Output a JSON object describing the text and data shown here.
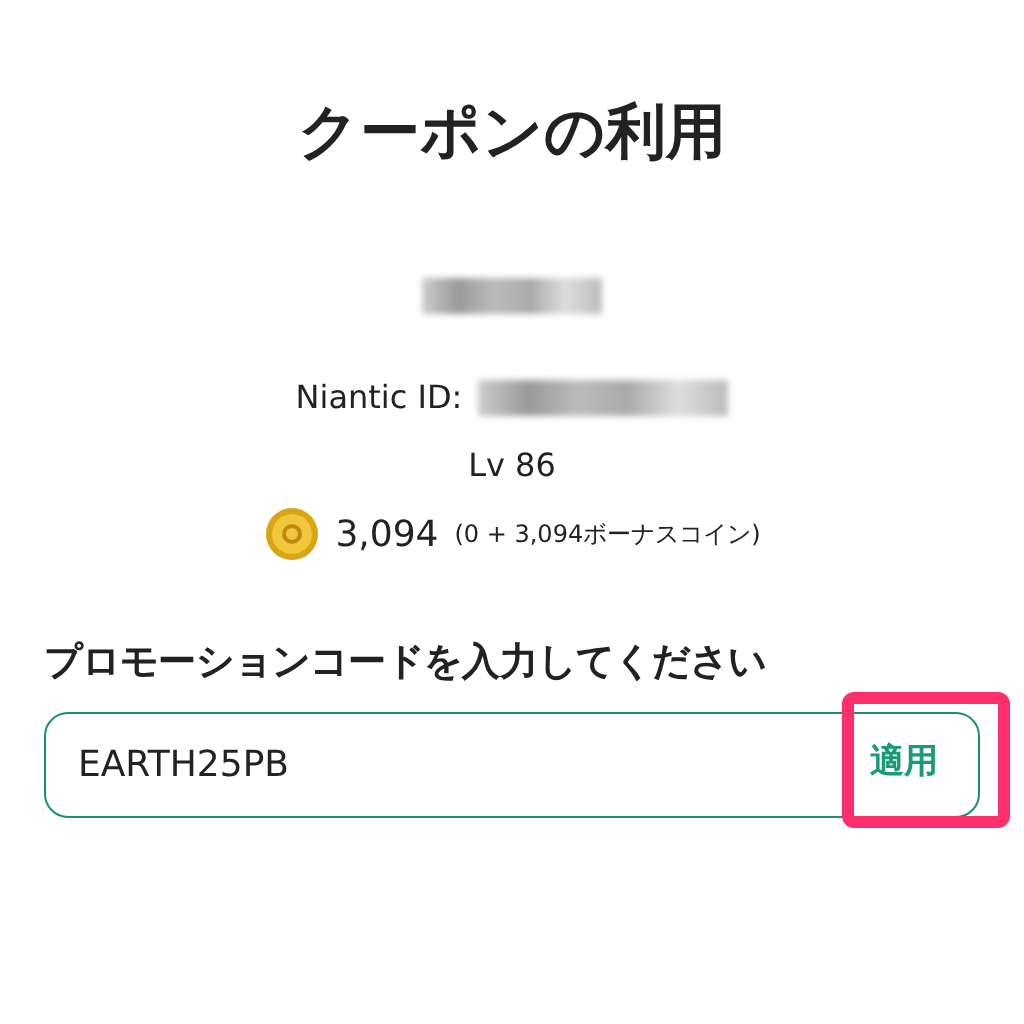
{
  "title": "クーポンの利用",
  "profile": {
    "username_blurred": true,
    "niantic_id_label": "Niantic ID:",
    "niantic_id_blurred": true,
    "level": "Lv 86",
    "coins": "3,094",
    "coins_breakdown": "(0 + 3,094ボーナスコイン)"
  },
  "promo": {
    "heading": "プロモーションコードを入力してください",
    "value": "EARTH25PB",
    "apply_label": "適用",
    "apply_highlighted": true
  }
}
